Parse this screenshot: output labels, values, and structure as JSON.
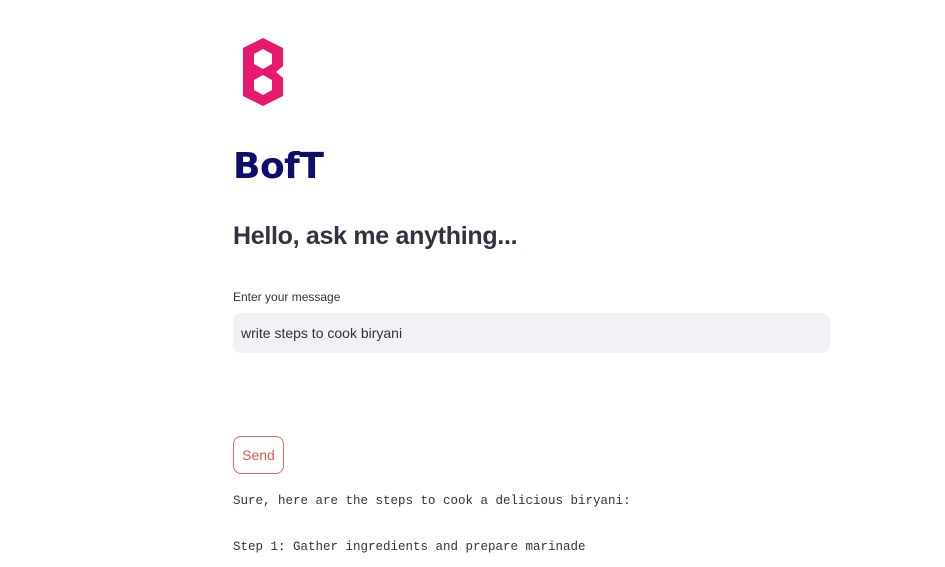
{
  "app": {
    "title": "BofT",
    "logo_color": "#e6196e",
    "title_color": "#0d0d6b"
  },
  "chat": {
    "greeting": "Hello, ask me anything...",
    "input_label": "Enter your message",
    "input_value": "write steps to cook biryani",
    "send_label": "Send",
    "accent_color": "#e5685e"
  },
  "response": {
    "lines": [
      "Sure, here are the steps to cook a delicious biryani:",
      "Step 1: Gather ingredients and prepare marinade"
    ]
  }
}
